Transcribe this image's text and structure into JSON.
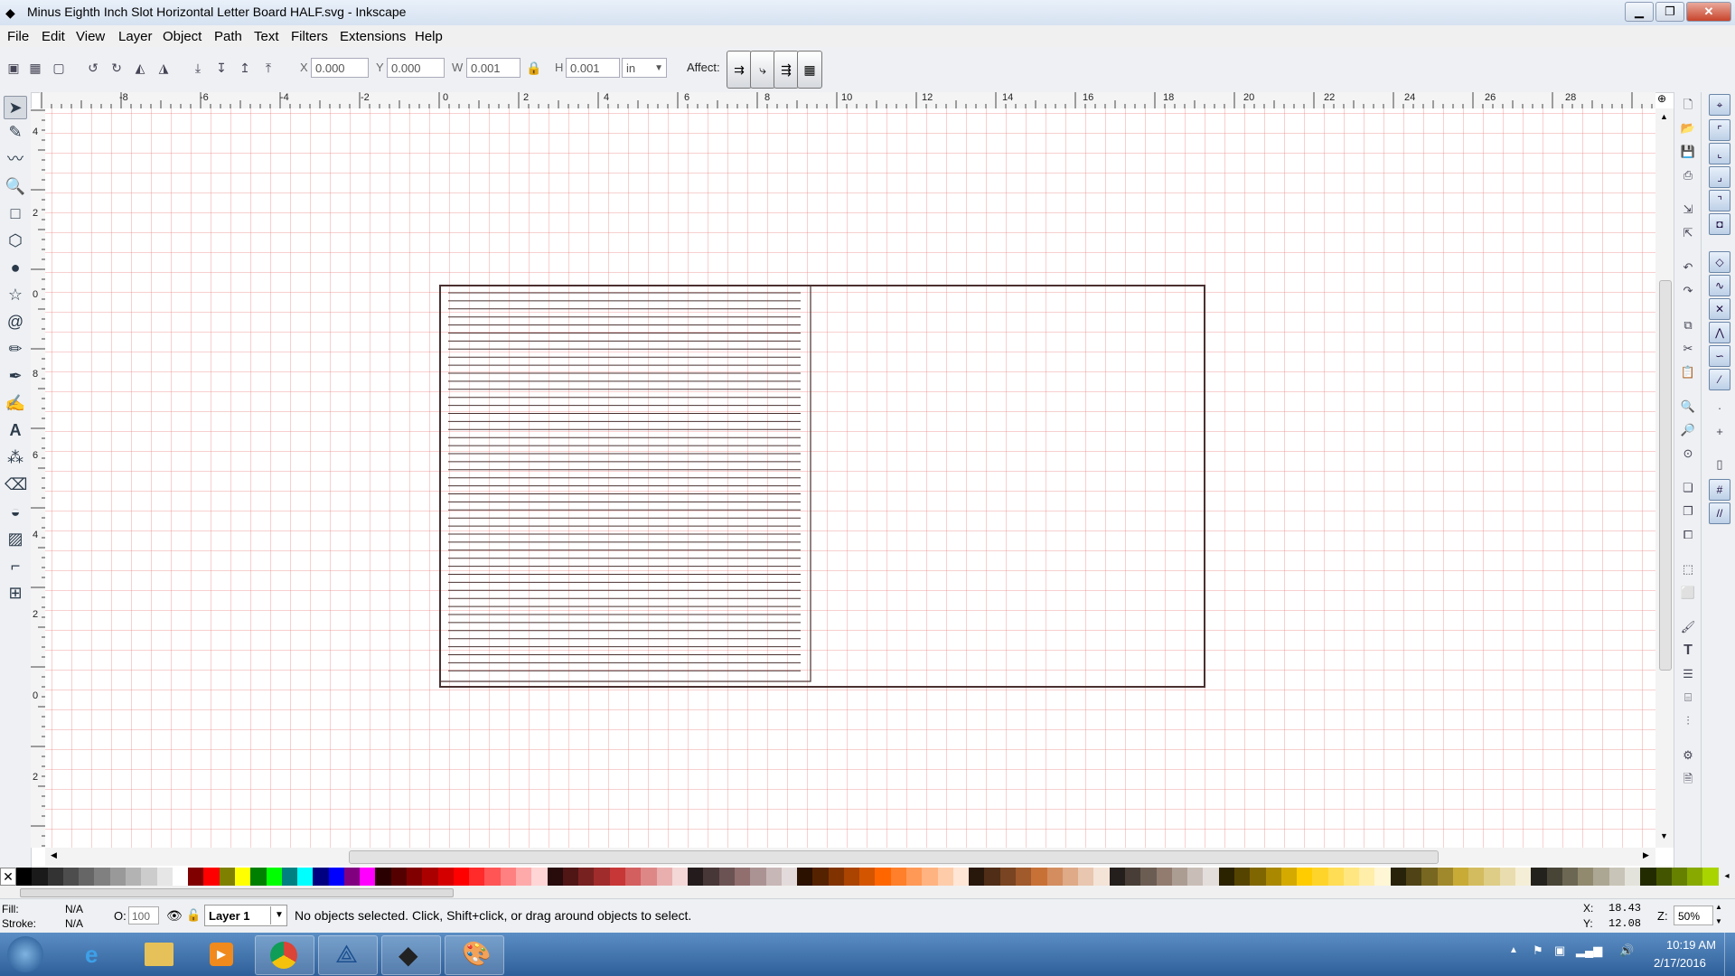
{
  "window": {
    "title": "Minus Eighth Inch Slot Horizontal Letter Board HALF.svg - Inkscape"
  },
  "menu": [
    "File",
    "Edit",
    "View",
    "Layer",
    "Object",
    "Path",
    "Text",
    "Filters",
    "Extensions",
    "Help"
  ],
  "toolbar": {
    "x_label": "X",
    "x_value": "0.000",
    "y_label": "Y",
    "y_value": "0.000",
    "w_label": "W",
    "w_value": "0.001",
    "h_label": "H",
    "h_value": "0.001",
    "unit": "in",
    "affect_label": "Affect:"
  },
  "ruler": {
    "h_labels": [
      "-8",
      "-6",
      "-4",
      "-2",
      "0",
      "2",
      "4",
      "6",
      "8",
      "10",
      "12",
      "14",
      "16",
      "18",
      "20",
      "22",
      "24",
      "26",
      "28"
    ],
    "v_labels": [
      "4",
      "2",
      "0",
      "8",
      "6",
      "4",
      "2",
      "0",
      "2"
    ]
  },
  "palette": [
    "#000000",
    "#1a1a1a",
    "#333333",
    "#4d4d4d",
    "#666666",
    "#808080",
    "#999999",
    "#b3b3b3",
    "#cccccc",
    "#e6e6e6",
    "#ffffff",
    "#800000",
    "#ff0000",
    "#808000",
    "#ffff00",
    "#008000",
    "#00ff00",
    "#008080",
    "#00ffff",
    "#000080",
    "#0000ff",
    "#800080",
    "#ff00ff",
    "#2b0000",
    "#550000",
    "#800000",
    "#aa0000",
    "#d40000",
    "#ff0000",
    "#ff2a2a",
    "#ff5555",
    "#ff8080",
    "#ffaaaa",
    "#ffd5d5",
    "#280b0b",
    "#501616",
    "#782121",
    "#a02c2c",
    "#c83737",
    "#d35f5f",
    "#de8787",
    "#e9afaf",
    "#f4d7d7",
    "#241c1c",
    "#483737",
    "#6c5353",
    "#916f6f",
    "#ac9393",
    "#c8b7b7",
    "#e3dbdb",
    "#2b1100",
    "#552200",
    "#803300",
    "#aa4400",
    "#d45500",
    "#ff6600",
    "#ff7f2a",
    "#ff9955",
    "#ffb380",
    "#ffccaa",
    "#ffe6d5",
    "#28170b",
    "#502d16",
    "#784421",
    "#a05a2c",
    "#c87137",
    "#d38d5f",
    "#deaa87",
    "#e9c6af",
    "#f4e3d7",
    "#241f1c",
    "#483e37",
    "#6c5d53",
    "#917c6f",
    "#ac9d93",
    "#c8beb7",
    "#e3dedb",
    "#2b2200",
    "#554400",
    "#806600",
    "#aa8800",
    "#d4aa00",
    "#ffcc00",
    "#ffd42a",
    "#ffdd55",
    "#ffe680",
    "#ffeeaa",
    "#fff6d5",
    "#28220b",
    "#504416",
    "#786721",
    "#a0892c",
    "#c8ab37",
    "#d3bc5f",
    "#decd87",
    "#e9ddaf",
    "#f4eed7",
    "#24221c",
    "#484537",
    "#6c6753",
    "#918a6f",
    "#aca793",
    "#c8c4b7",
    "#e3e2db",
    "#222b00",
    "#445500",
    "#668000",
    "#88aa00",
    "#aad400"
  ],
  "status": {
    "fill_label": "Fill:",
    "fill_value": "N/A",
    "stroke_label": "Stroke:",
    "stroke_value": "N/A",
    "opacity_label": "O:",
    "opacity_value": "100",
    "layer": "Layer 1",
    "message": "No objects selected. Click, Shift+click, or drag around objects to select.",
    "x_label": "X:",
    "x_value": "18.43",
    "y_label": "Y:",
    "y_value": "12.08",
    "zoom_label": "Z:",
    "zoom_value": "50%"
  },
  "taskbar": {
    "time": "10:19 AM",
    "date": "2/17/2016",
    "apps": [
      "start-orb",
      "internet-explorer",
      "file-explorer",
      "media-player",
      "chrome",
      "cricut",
      "inkscape",
      "paint"
    ]
  },
  "artwork": {
    "slot_count": 48
  }
}
